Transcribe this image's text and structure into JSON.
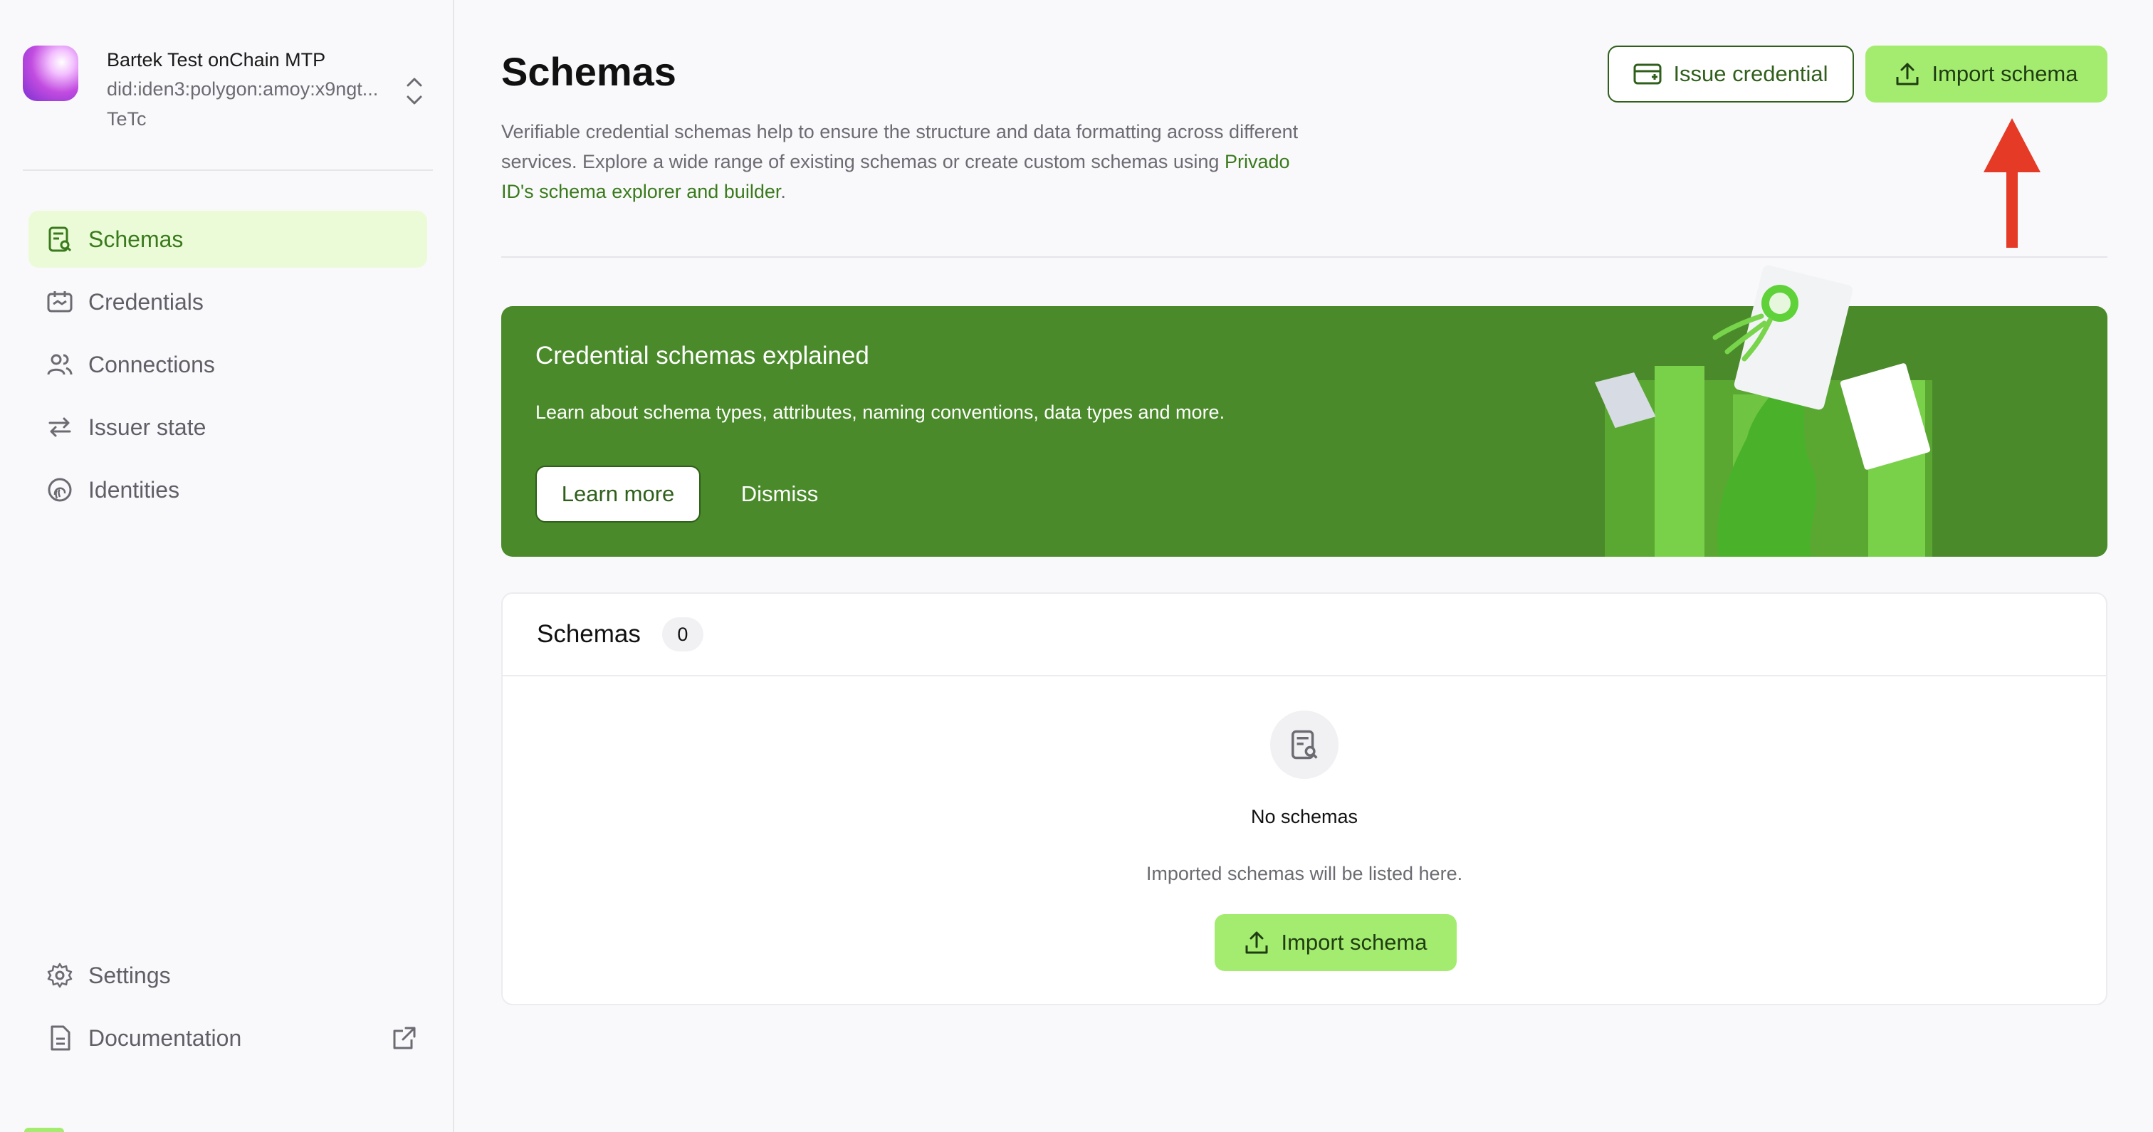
{
  "identity": {
    "name": "Bartek Test onChain MTP",
    "did": "did:iden3:polygon:amoy:x9ngt...TeTc"
  },
  "nav": {
    "items": [
      {
        "label": "Schemas",
        "icon": "schema-icon",
        "active": true
      },
      {
        "label": "Credentials",
        "icon": "credential-icon",
        "active": false
      },
      {
        "label": "Connections",
        "icon": "users-icon",
        "active": false
      },
      {
        "label": "Issuer state",
        "icon": "arrows-swap-icon",
        "active": false
      },
      {
        "label": "Identities",
        "icon": "fingerprint-icon",
        "active": false
      }
    ],
    "bottom": [
      {
        "label": "Settings",
        "icon": "gear-icon"
      },
      {
        "label": "Documentation",
        "icon": "document-icon"
      }
    ]
  },
  "header": {
    "title": "Schemas",
    "description_prefix": "Verifiable credential schemas help to ensure the structure and data formatting across different services. Explore a wide range of existing schemas or create custom schemas using ",
    "description_link": "Privado ID's schema explorer and builder",
    "description_suffix": ".",
    "issue_credential_label": "Issue credential",
    "import_schema_label": "Import schema"
  },
  "banner": {
    "title": "Credential schemas explained",
    "text": "Learn about schema types, attributes, naming conventions, data types and more.",
    "learn_more_label": "Learn more",
    "dismiss_label": "Dismiss"
  },
  "schemas_card": {
    "title": "Schemas",
    "count": "0",
    "empty_title": "No schemas",
    "empty_text": "Imported schemas will be listed here.",
    "import_label": "Import schema"
  },
  "colors": {
    "accent_green": "#a4ec6f",
    "dark_green": "#2f5f1a",
    "banner_green": "#4a8a2a",
    "active_nav_bg": "#ebfbd8",
    "annotation_arrow": "#e53a26"
  }
}
